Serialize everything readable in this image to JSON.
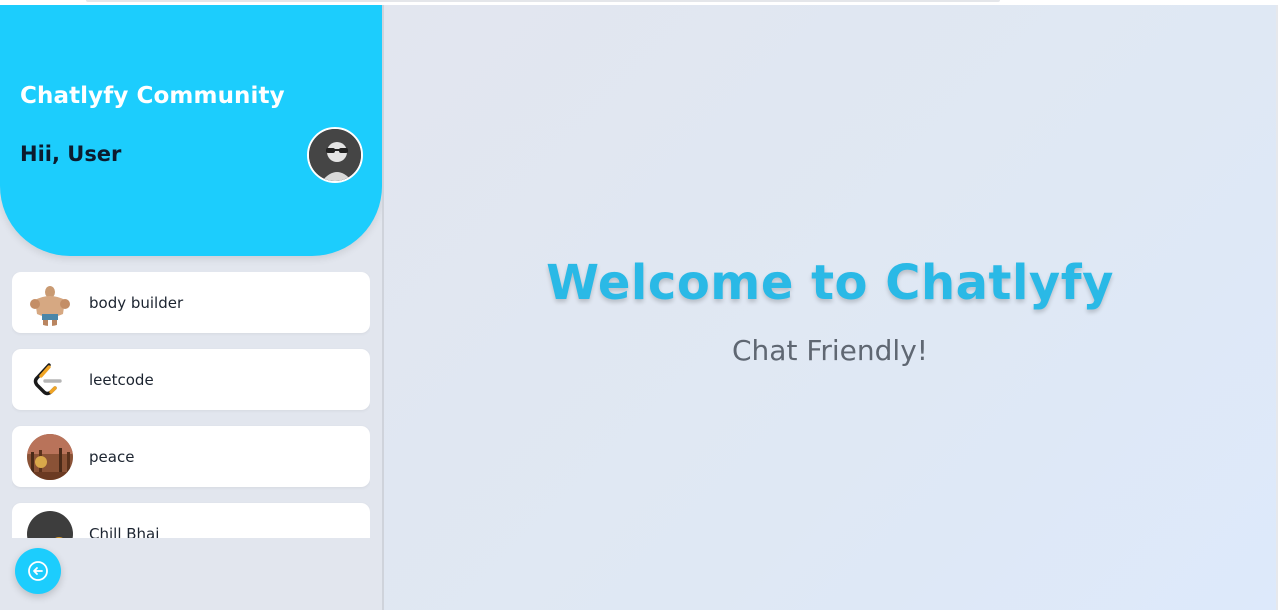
{
  "sidebar": {
    "community_title": "Chatlyfy Community",
    "greeting": "Hii, User",
    "user_avatar_icon": "user-sunglasses-icon",
    "chats": [
      {
        "name": "body builder",
        "avatar_icon": "bodybuilder-avatar"
      },
      {
        "name": "leetcode",
        "avatar_icon": "leetcode-logo"
      },
      {
        "name": "peace",
        "avatar_icon": "peace-avatar"
      },
      {
        "name": "Chill Bhai",
        "avatar_icon": "chill-avatar"
      }
    ],
    "logout_icon": "logout-icon"
  },
  "main": {
    "welcome_title": "Welcome to Chatlyfy",
    "welcome_subtitle": "Chat Friendly!"
  },
  "colors": {
    "accent": "#1ccdfd",
    "title": "#2ab9e6",
    "sidebar_bg": "#e2e6ee"
  }
}
